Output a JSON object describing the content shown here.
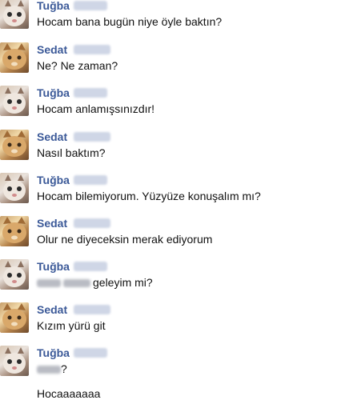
{
  "messages": [
    {
      "sender": "Tuğba",
      "avatar": "cat-calico-icon",
      "text": "Hocam bana bugün niye öyle baktın?"
    },
    {
      "sender": "Sedat",
      "avatar": "cat-orange-icon",
      "text": "Ne? Ne zaman?"
    },
    {
      "sender": "Tuğba",
      "avatar": "cat-calico-icon",
      "text": "Hocam anlamışsınızdır!"
    },
    {
      "sender": "Sedat",
      "avatar": "cat-orange-icon",
      "text": "Nasıl baktım?"
    },
    {
      "sender": "Tuğba",
      "avatar": "cat-calico-icon",
      "text": "Hocam bilemiyorum. Yüzyüze konuşalım mı?"
    },
    {
      "sender": "Sedat",
      "avatar": "cat-orange-icon",
      "text": "Olur ne diyeceksin merak ediyorum"
    },
    {
      "sender": "Tuğba",
      "avatar": "cat-calico-icon",
      "text": "geleyim mi?"
    },
    {
      "sender": "Sedat",
      "avatar": "cat-orange-icon",
      "text": "Kızım yürü git"
    },
    {
      "sender": "Tuğba",
      "avatar": "cat-calico-icon",
      "text": "?"
    }
  ],
  "last_line": "Hocaaaaaaa"
}
